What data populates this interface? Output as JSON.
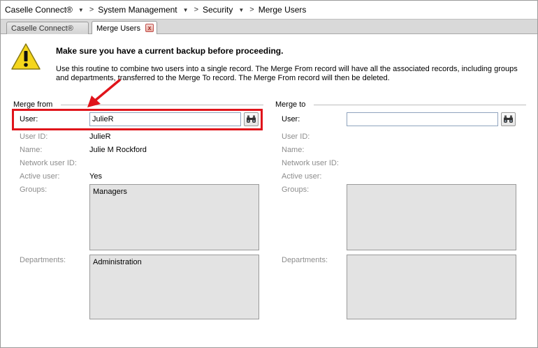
{
  "breadcrumb": {
    "items": [
      "Caselle Connect®",
      "System Management",
      "Security",
      "Merge Users"
    ]
  },
  "tabs": {
    "caselle": "Caselle Connect®",
    "merge": "Merge Users",
    "close_glyph": "x"
  },
  "warning": {
    "icon": "warning-icon",
    "title": "Make sure you have a current backup before proceeding.",
    "body": "Use this routine to combine two users into a single record.  The Merge From record will have all the associated records, including groups and departments, transferred to the Merge To record. The Merge From record will then be deleted."
  },
  "merge_from": {
    "header": "Merge from",
    "user_label": "User:",
    "user_value": "JulieR",
    "user_id_label": "User ID:",
    "user_id_value": "JulieR",
    "name_label": "Name:",
    "name_value": "Julie M Rockford",
    "network_label": "Network user ID:",
    "active_label": "Active user:",
    "active_value": "Yes",
    "groups_label": "Groups:",
    "groups": [
      "Managers"
    ],
    "departments_label": "Departments:",
    "departments": [
      "Administration"
    ]
  },
  "merge_to": {
    "header": "Merge to",
    "user_label": "User:",
    "user_value": "",
    "user_id_label": "User ID:",
    "name_label": "Name:",
    "network_label": "Network user ID:",
    "active_label": "Active user:",
    "groups_label": "Groups:",
    "groups": [],
    "departments_label": "Departments:",
    "departments": []
  },
  "colors": {
    "highlight": "#e0141b",
    "arrow": "#e0141b",
    "warning_fill": "#f5d61c"
  }
}
